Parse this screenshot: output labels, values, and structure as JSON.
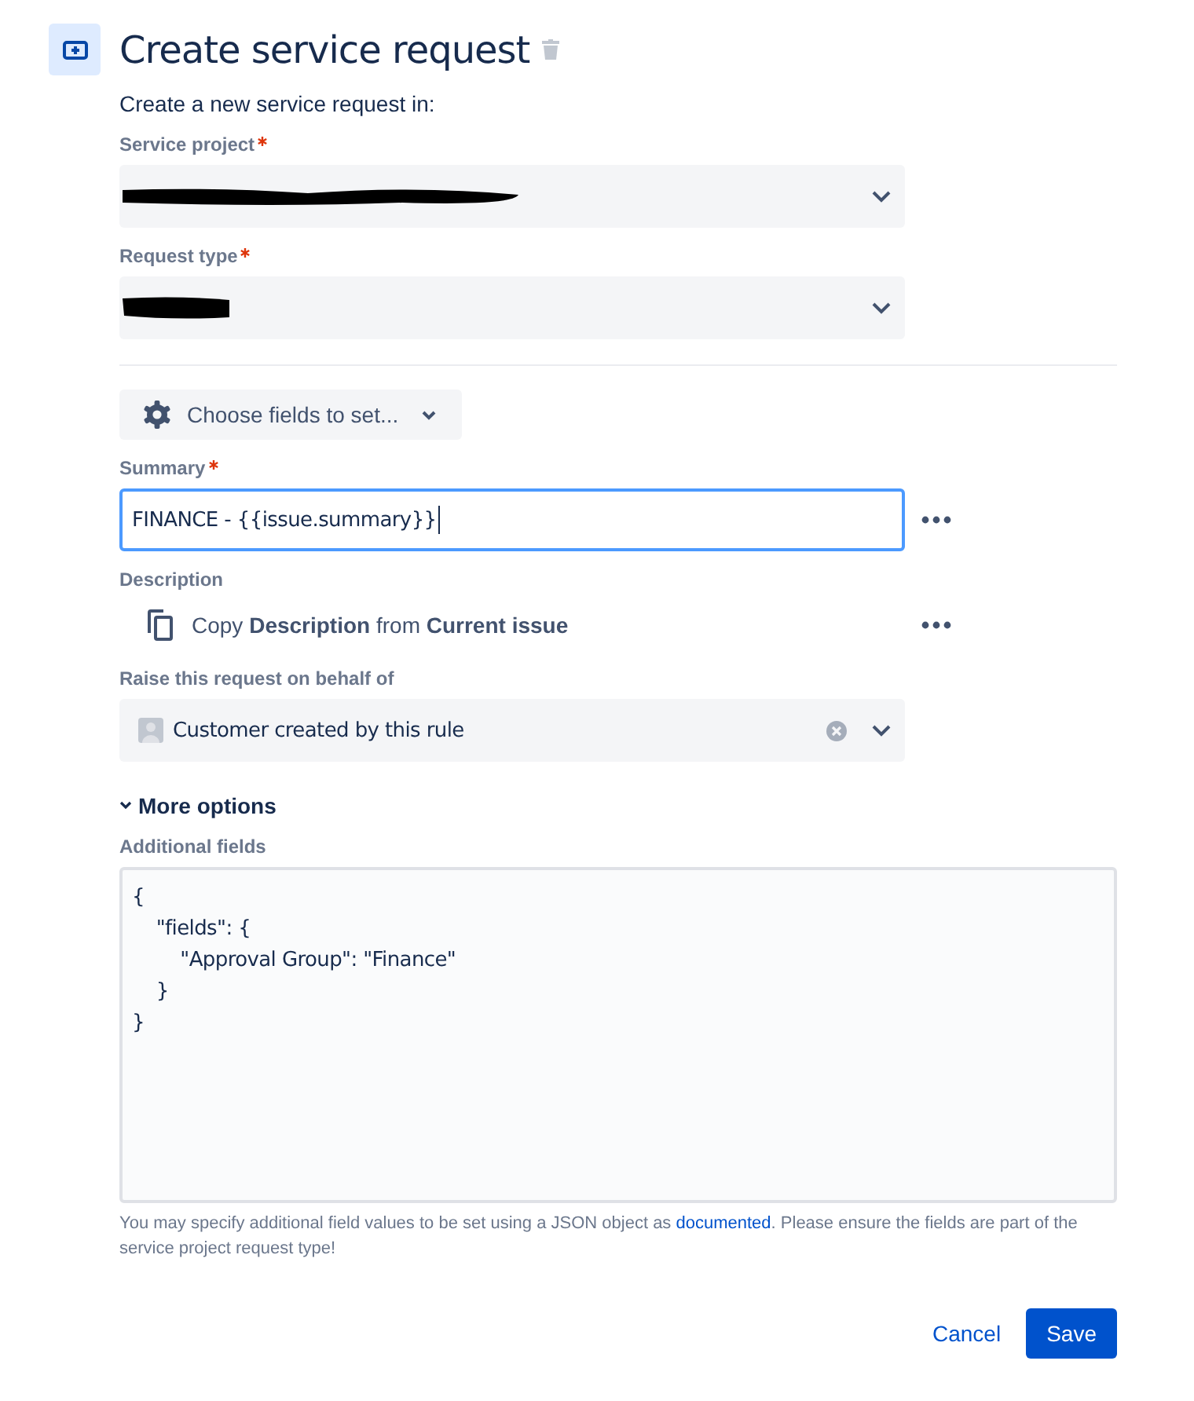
{
  "header": {
    "title": "Create service request",
    "subtitle": "Create a new service request in:"
  },
  "project_select": {
    "label": "Service project",
    "required": true,
    "value_redacted": true
  },
  "type_select": {
    "label": "Request type",
    "required": true,
    "value_redacted": true
  },
  "choose_fields": {
    "label": "Choose fields to set..."
  },
  "summary": {
    "label": "Summary",
    "required": true,
    "value": "FINANCE - {{issue.summary}}",
    "focused": true
  },
  "description": {
    "label": "Description",
    "text": "Copy **Description** from **Current issue**"
  },
  "behalf": {
    "label": "Raise this request on behalf of",
    "value": "Customer created by this rule"
  },
  "more_options": {
    "label": "More options",
    "expanded": true
  },
  "additional": {
    "label": "Additional fields",
    "code": "{\n    \"fields\": {\n        \"Approval Group\": \"Finance\"\n    }\n}",
    "help_before": "You may specify additional field values to be set using a JSON object as ",
    "help_link": "documented",
    "help_after": ". Please ensure the fields are part of the service project request type!"
  },
  "buttons": [
    {
      "label": "Cancel",
      "kind": "link"
    },
    {
      "label": "Save",
      "kind": "primary"
    }
  ]
}
